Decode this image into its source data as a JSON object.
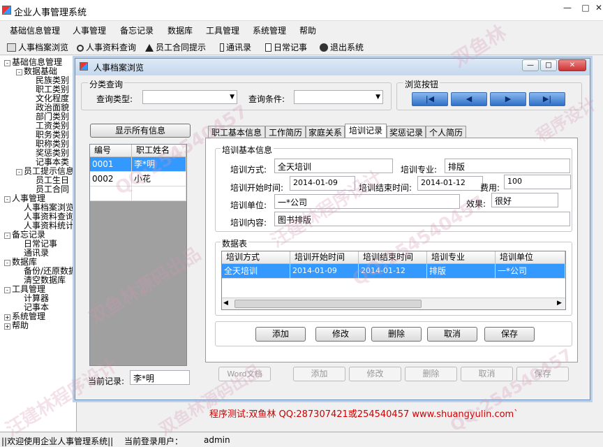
{
  "app": {
    "title": "企业人事管理系统",
    "min": "—",
    "max": "□",
    "close": "✕"
  },
  "menu": [
    "基础信息管理",
    "人事管理",
    "备忘记录",
    "数据库",
    "工具管理",
    "系统管理",
    "帮助"
  ],
  "toolbar": [
    "人事档案浏览",
    "人事资料查询",
    "员工合同提示",
    "通讯录",
    "日常记事",
    "退出系统"
  ],
  "tree": [
    {
      "t": "基础信息管理",
      "l": 0,
      "e": "-"
    },
    {
      "t": "数据基础",
      "l": 1,
      "e": "-"
    },
    {
      "t": "民族类别",
      "l": 2
    },
    {
      "t": "职工类别",
      "l": 2
    },
    {
      "t": "文化程度",
      "l": 2
    },
    {
      "t": "政治面貌",
      "l": 2
    },
    {
      "t": "部门类别",
      "l": 2
    },
    {
      "t": "工资类别",
      "l": 2
    },
    {
      "t": "职务类别",
      "l": 2
    },
    {
      "t": "职称类别",
      "l": 2
    },
    {
      "t": "奖惩类别",
      "l": 2
    },
    {
      "t": "记事本类",
      "l": 2
    },
    {
      "t": "员工提示信息",
      "l": 1,
      "e": "-"
    },
    {
      "t": "员工生日",
      "l": 2
    },
    {
      "t": "员工合同",
      "l": 2
    },
    {
      "t": "人事管理",
      "l": 0,
      "e": "-"
    },
    {
      "t": "人事档案浏览",
      "l": 1
    },
    {
      "t": "人事资料查询",
      "l": 1
    },
    {
      "t": "人事资料统计",
      "l": 1
    },
    {
      "t": "备忘记录",
      "l": 0,
      "e": "-"
    },
    {
      "t": "日常记事",
      "l": 1
    },
    {
      "t": "通讯录",
      "l": 1
    },
    {
      "t": "数据库",
      "l": 0,
      "e": "-"
    },
    {
      "t": "备份/还原数据库",
      "l": 1
    },
    {
      "t": "清空数据库",
      "l": 1
    },
    {
      "t": "工具管理",
      "l": 0,
      "e": "-"
    },
    {
      "t": "计算器",
      "l": 1
    },
    {
      "t": "记事本",
      "l": 1
    },
    {
      "t": "系统管理",
      "l": 0,
      "e": "+"
    },
    {
      "t": "帮助",
      "l": 0,
      "e": "+"
    }
  ],
  "child": {
    "title": "人事档案浏览",
    "min": "—",
    "max": "□",
    "close": "✕"
  },
  "query": {
    "group": "分类查询",
    "type_label": "查询类型:",
    "type_value": "",
    "cond_label": "查询条件:",
    "cond_value": ""
  },
  "nav": {
    "group": "浏览按钮",
    "first": "|◀",
    "prev": "◀",
    "next": "▶",
    "last": "▶|"
  },
  "left": {
    "show_all": "显示所有信息",
    "headers": [
      "编号",
      "职工姓名"
    ],
    "rows": [
      [
        "0001",
        "李*明"
      ],
      [
        "0002",
        "小花"
      ]
    ],
    "current_label": "当前记录:",
    "current_value": "李*明"
  },
  "tabs": [
    "职工基本信息",
    "工作简历",
    "家庭关系",
    "培训记录",
    "奖惩记录",
    "个人简历"
  ],
  "train": {
    "group": "培训基本信息",
    "method_label": "培训方式:",
    "method": "全天培训",
    "major_label": "培训专业:",
    "major": "排版",
    "start_label": "培训开始时间:",
    "start": "2014-01-09",
    "end_label": "培训结束时间:",
    "end": "2014-01-12",
    "fee_label": "费用:",
    "fee": "100",
    "unit_label": "培训单位:",
    "unit": "一*公司",
    "effect_label": "效果:",
    "effect": "很好",
    "content_label": "培训内容:",
    "content": "图书排版"
  },
  "table": {
    "group": "数据表",
    "headers": [
      "培训方式",
      "培训开始时间",
      "培训结束时间",
      "培训专业",
      "培训单位"
    ],
    "rows": [
      [
        "全天培训",
        "2014-01-09",
        "2014-01-12",
        "排版",
        "一*公司"
      ]
    ]
  },
  "inner_buttons": [
    "添加",
    "修改",
    "删除",
    "取消",
    "保存"
  ],
  "bottom_buttons": [
    "Word文档",
    "添加",
    "修改",
    "删除",
    "取消",
    "保存"
  ],
  "footer_text": "程序测试:双鱼林 QQ:287307421或254540457 www.shuangyulin.com`",
  "status": {
    "welcome": "||欢迎使用企业人事管理系统||",
    "user_label": "当前登录用户：",
    "user": "admin"
  },
  "watermarks": [
    "双鱼林",
    "QQ:254540457",
    "汪建林程序设计",
    "双鱼林源码出品",
    "QQ:254540457",
    "汪建林程序设计",
    "双鱼林源码出品",
    "QQ:254540457",
    "程序设计"
  ],
  "colors": {
    "accent": "#3399ff",
    "footer_text": "#cc0000",
    "title_bar": "#c5d7ee"
  }
}
